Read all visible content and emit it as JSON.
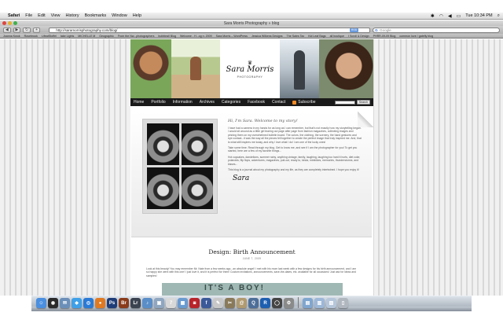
{
  "menubar": {
    "items": [
      "Safari",
      "File",
      "Edit",
      "View",
      "History",
      "Bookmarks",
      "Window",
      "Help"
    ],
    "clock": "Tue 10:34 PM"
  },
  "browser": {
    "window_title": "Sara Morris Photography » blog",
    "url": "http://saramorrisphotography.com/blog/",
    "search_placeholder": "Google",
    "bookmarks": [
      "Joanna Kwok",
      "Rosebrook",
      "LifeatStoffel",
      "take Lights",
      "MICHELLE M",
      "Geographic",
      "From the Nw...photographers",
      "bubbleall Blog",
      "Welcome - H...og n. 2009",
      "Sara Morris – WordPress",
      "Jessica Wilkens Designs",
      "The Sales Tax",
      "Kid Leaf Bags",
      "all boutique",
      "I Scroll & Design",
      "PHRR-09-09 Blog",
      "common love / gatefly blog"
    ]
  },
  "site": {
    "logo_script": "Sara Morris",
    "logo_sub": "PHOTOGRAPHY",
    "nav": [
      "Home",
      "Portfolio",
      "Information",
      "Archives",
      "Categories",
      "Facebook",
      "Contact",
      "Subscribe"
    ],
    "search_button": "Search"
  },
  "welcome": {
    "heading": "Hi, I'm Sara. Welcome to my story!",
    "paragraphs": [
      "I have had a camera in my hands for as long as I can remember, but that's not exactly how my storytelling began. I would sit around as a little girl tearing out page after page from fashion magazines, collecting images and pinning them on my overwhelmed bulletin board. The colors, the clothing, the scenery, the hand gestures and eye contact...it was the way all the pieces fell together to create the perfect image that truly inspired me. And, that is what still inspires me today, and why I love what I do! I am one of the lucky ones!",
      "Take some time. Read through my blog. Get to know me, and see if I am the photographer for you! To get you started, here are a few of my favorite things...",
      "Hot cupcakes, dandelions, summer rainy, anything vintage, family, laughing, laughing too hard it hurts, diet coke, polaroids, flip flops, adventures, magazines, pull-out, ready to, kinda, minibikes, memories, thunderstorms, and kisses...",
      "This blog is a journal about my photography and my life, as they are completely intertwined. I hope you enjoy it!"
    ],
    "signature": "Sara"
  },
  "post": {
    "title": "Design: Birth Announcement",
    "date": "JUNE 7, 2009",
    "body": "Look at this beauty! You may remember Mr. Nate from a few weeks ago...an absolute angel! I met with his mom last week with a few designs for his birth announcement, and I am so happy she went with this one! I just love it, and it is perfect for them! Custom invitations, announcements, save-the-dates, etc. available for all occasions! Just ask for ideas and samples!",
    "image_text": "IT'S A BOY!"
  },
  "dock": {
    "icons": [
      {
        "name": "finder",
        "color": "#4a8fe0",
        "glyph": "☺"
      },
      {
        "name": "dashboard",
        "color": "#2b2b2b",
        "glyph": "◉"
      },
      {
        "name": "mail",
        "color": "#6b8fb8",
        "glyph": "✉"
      },
      {
        "name": "ichat",
        "color": "#3fa0e8",
        "glyph": "◆"
      },
      {
        "name": "safari",
        "color": "#2a7ad6",
        "glyph": "◎"
      },
      {
        "name": "firefox",
        "color": "#e07a22",
        "glyph": "●"
      },
      {
        "name": "photoshop",
        "color": "#1f3d78",
        "glyph": "Ps"
      },
      {
        "name": "bridge",
        "color": "#8a3b1a",
        "glyph": "Br"
      },
      {
        "name": "lightroom",
        "color": "#3b4350",
        "glyph": "Lr"
      },
      {
        "name": "itunes",
        "color": "#5a8ec8",
        "glyph": "♪"
      },
      {
        "name": "preview",
        "color": "#8fa6c0",
        "glyph": "▣"
      },
      {
        "name": "ical",
        "color": "#d8d8d8",
        "glyph": "7"
      },
      {
        "name": "iphoto",
        "color": "#6a9bd0",
        "glyph": "▦"
      },
      {
        "name": "photo-booth",
        "color": "#b8242a",
        "glyph": "◙"
      },
      {
        "name": "facebook-app",
        "color": "#3b5998",
        "glyph": "f"
      },
      {
        "name": "textedit",
        "color": "#c8c8c8",
        "glyph": "✎"
      },
      {
        "name": "script-editor",
        "color": "#8a7a5a",
        "glyph": "✂"
      },
      {
        "name": "address-book",
        "color": "#b09a70",
        "glyph": "@"
      },
      {
        "name": "quicktime",
        "color": "#4d6e99",
        "glyph": "Q"
      },
      {
        "name": "reeder",
        "color": "#1d5fb0",
        "glyph": "R"
      },
      {
        "name": "aperture",
        "color": "#444",
        "glyph": "◯"
      },
      {
        "name": "system-preferences",
        "color": "#8a8a8a",
        "glyph": "⚙"
      },
      {
        "name": "stacks-applications",
        "color": "#7fa6cf",
        "glyph": "▤"
      },
      {
        "name": "stacks-downloads",
        "color": "#9db7d8",
        "glyph": "▥"
      },
      {
        "name": "stacks-documents",
        "color": "#b6c6da",
        "glyph": "▧"
      },
      {
        "name": "trash",
        "color": "#b0b7bf",
        "glyph": "▯"
      }
    ]
  }
}
